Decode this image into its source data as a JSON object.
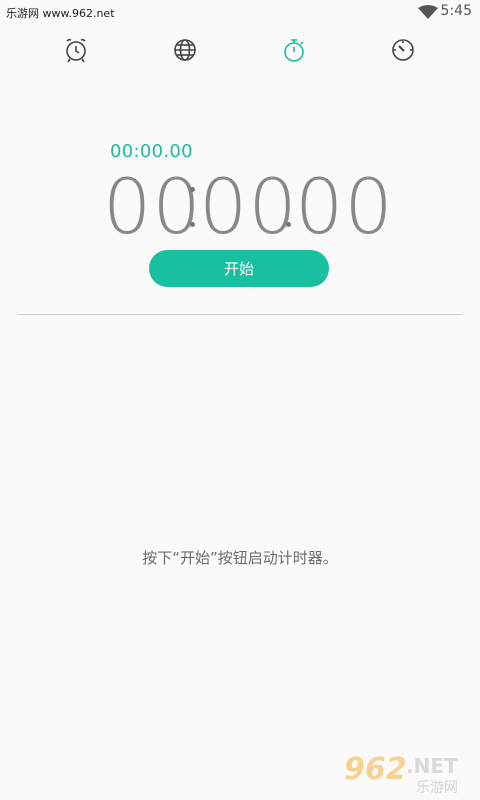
{
  "status_bar": {
    "watermark": "乐游网 www.962.net",
    "time": "5:45"
  },
  "tabs": [
    {
      "name": "alarm",
      "icon": "alarm-clock-icon",
      "active": false
    },
    {
      "name": "world-clock",
      "icon": "globe-icon",
      "active": false
    },
    {
      "name": "stopwatch",
      "icon": "stopwatch-icon",
      "active": true
    },
    {
      "name": "timer",
      "icon": "timer-dial-icon",
      "active": false
    }
  ],
  "stopwatch": {
    "lap_time": "00:00.00",
    "minutes": "00",
    "seconds": "00",
    "hundredths": "00"
  },
  "start_button": {
    "label": "开始"
  },
  "hint": "按下“开始”按钮启动计时器。",
  "watermark_logo": {
    "number": "962",
    "domain": ".NET",
    "name": "乐游网"
  },
  "colors": {
    "accent": "#18bfa0",
    "inactive_icon": "#444444",
    "timer_digits": "#888888",
    "background": "#fafafa"
  }
}
